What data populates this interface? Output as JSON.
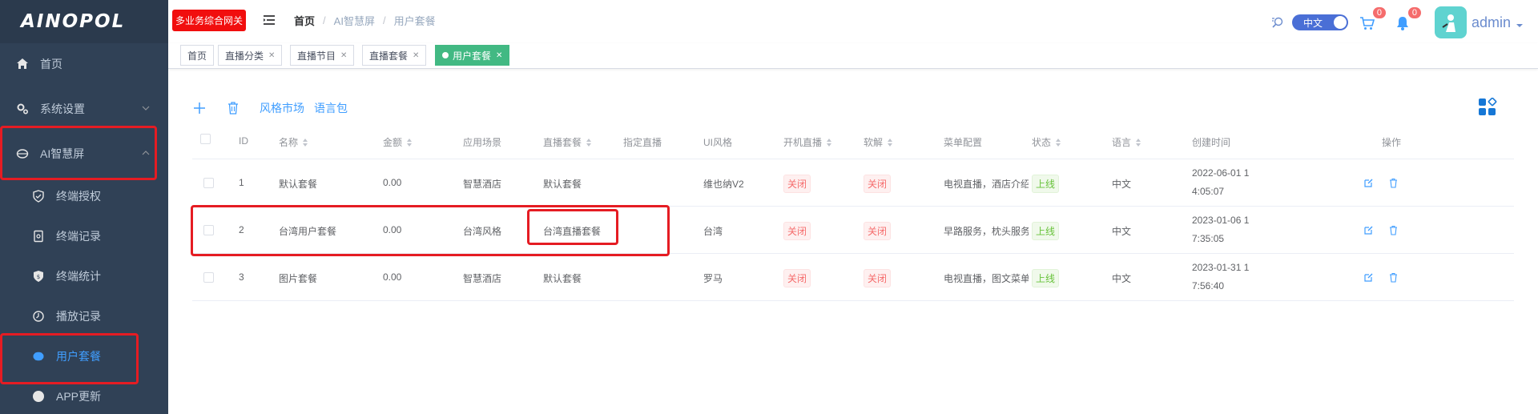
{
  "brand": {
    "logo_text": "AINOPOL"
  },
  "sidebar": {
    "items": [
      {
        "label": "首页",
        "icon": "home-icon"
      },
      {
        "label": "系统设置",
        "icon": "gear-icon"
      },
      {
        "label": "AI智慧屏",
        "icon": "screen-icon"
      },
      {
        "label": "终端授权",
        "icon": "shield-icon"
      },
      {
        "label": "终端记录",
        "icon": "record-icon"
      },
      {
        "label": "终端统计",
        "icon": "stats-icon"
      },
      {
        "label": "播放记录",
        "icon": "clock-icon"
      },
      {
        "label": "用户套餐",
        "icon": "package-icon"
      },
      {
        "label": "APP更新",
        "icon": "app-icon"
      }
    ]
  },
  "header": {
    "badge": "多业务综合网关",
    "breadcrumb": [
      "首页",
      "AI智慧屏",
      "用户套餐"
    ],
    "lang": "中文",
    "cart_count": "0",
    "bell_count": "0",
    "username": "admin"
  },
  "tags": [
    {
      "label": "首页"
    },
    {
      "label": "直播分类"
    },
    {
      "label": "直播节目"
    },
    {
      "label": "直播套餐"
    },
    {
      "label": "用户套餐"
    }
  ],
  "toolbar": {
    "market": "风格市场",
    "langpack": "语言包"
  },
  "table": {
    "headers": [
      "ID",
      "名称",
      "金额",
      "应用场景",
      "直播套餐",
      "指定直播",
      "UI风格",
      "开机直播",
      "软解",
      "菜单配置",
      "状态",
      "语言",
      "创建时间",
      "操作"
    ],
    "rows": [
      {
        "id": "1",
        "name": "默认套餐",
        "amount": "0.00",
        "scene": "智慧酒店",
        "live_pkg": "默认套餐",
        "specified": "",
        "ui": "维也纳V2",
        "boot": "关闭",
        "soft": "关闭",
        "menu": "电视直播，酒店介绍",
        "status": "上线",
        "lang": "中文",
        "time1": "2022-06-01 1",
        "time2": "4:05:07"
      },
      {
        "id": "2",
        "name": "台湾用户套餐",
        "amount": "0.00",
        "scene": "台湾风格",
        "live_pkg": "台湾直播套餐",
        "specified": "",
        "ui": "台湾",
        "boot": "关闭",
        "soft": "关闭",
        "menu": "早路服务，枕头服务",
        "status": "上线",
        "lang": "中文",
        "time1": "2023-01-06 1",
        "time2": "7:35:05"
      },
      {
        "id": "3",
        "name": "图片套餐",
        "amount": "0.00",
        "scene": "智慧酒店",
        "live_pkg": "默认套餐",
        "specified": "",
        "ui": "罗马",
        "boot": "关闭",
        "soft": "关闭",
        "menu": "电视直播，图文菜单",
        "status": "上线",
        "lang": "中文",
        "time1": "2023-01-31 1",
        "time2": "7:56:40"
      }
    ]
  },
  "colors": {
    "sidebar_bg": "#304156",
    "accent": "#409eff",
    "active_tag": "#42b983",
    "highlight": "#e51c23"
  }
}
